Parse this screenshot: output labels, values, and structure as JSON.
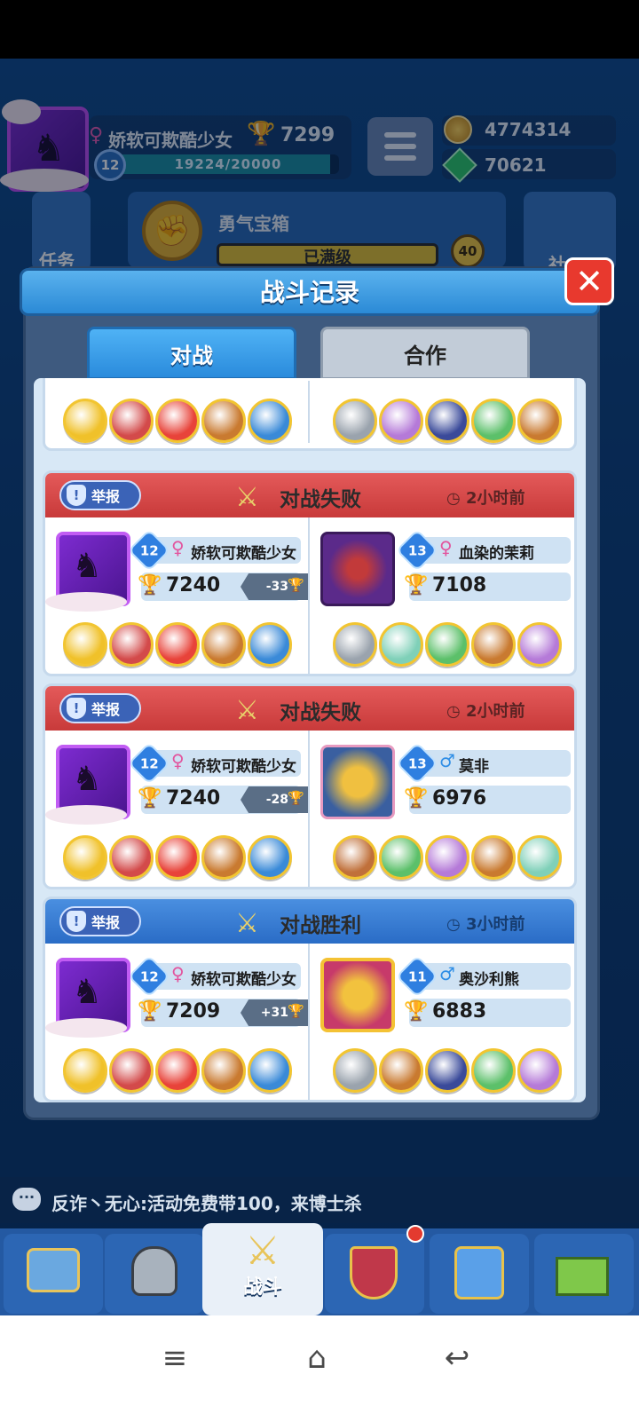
{
  "hud": {
    "player_name": "娇软可欺酷少女",
    "trophies": "7299",
    "level": "12",
    "xp": "19224/20000",
    "xp_fraction": 0.9612,
    "coins": "4774314",
    "gems": "70621"
  },
  "chest": {
    "title": "勇气宝箱",
    "status": "已满级",
    "level": "40"
  },
  "side": {
    "tasks_label": "任务",
    "social_label": "社"
  },
  "modal": {
    "title": "战斗记录",
    "close_label": "✕",
    "tabs": [
      {
        "label": "对战",
        "active": true
      },
      {
        "label": "合作",
        "active": false
      }
    ]
  },
  "report_label": "举报",
  "records": [
    {
      "result": "对战失败",
      "outcome": "lose",
      "time": "2小时前",
      "self": {
        "level": "12",
        "gender": "♀",
        "name": "娇软可欺酷少女",
        "trophies": "7240",
        "delta": "-33",
        "heroes": [
          "yellow",
          "red",
          "clown",
          "bear",
          "blue"
        ]
      },
      "opponent": {
        "level": "13",
        "gender": "♀",
        "name": "血染的茉莉",
        "trophies": "7108",
        "heroes": [
          "knight",
          "teal",
          "green",
          "bear",
          "purple"
        ]
      }
    },
    {
      "result": "对战失败",
      "outcome": "lose",
      "time": "2小时前",
      "self": {
        "level": "12",
        "gender": "♀",
        "name": "娇软可欺酷少女",
        "trophies": "7240",
        "delta": "-28",
        "heroes": [
          "yellow",
          "red",
          "clown",
          "bear",
          "blue"
        ]
      },
      "opponent": {
        "level": "13",
        "gender": "♂",
        "name": "莫非",
        "trophies": "6976",
        "heroes": [
          "monkey",
          "green",
          "purple",
          "bear",
          "teal"
        ]
      }
    },
    {
      "result": "对战胜利",
      "outcome": "win",
      "time": "3小时前",
      "self": {
        "level": "12",
        "gender": "♀",
        "name": "娇软可欺酷少女",
        "trophies": "7209",
        "delta": "+31",
        "heroes": [
          "yellow",
          "red",
          "clown",
          "bear",
          "blue"
        ]
      },
      "opponent": {
        "level": "11",
        "gender": "♂",
        "name": "奥沙利熊",
        "trophies": "6883",
        "heroes": [
          "knight",
          "bear",
          "ninja",
          "green",
          "purple"
        ]
      }
    }
  ],
  "hero_colors": {
    "yellow": "#f0c12a",
    "red": "#d34a4a",
    "clown": "#e8433a",
    "bear": "#c97a30",
    "blue": "#3a8ad8",
    "knight": "#9aa3ad",
    "purple": "#b57ad8",
    "ninja": "#3a4a9a",
    "green": "#5cc06a",
    "teal": "#7fd0b8",
    "monkey": "#c0703a"
  },
  "chat": {
    "icon": "···",
    "message": "反诈丶无心:活动免费带100，来博士杀"
  },
  "bottom_tabs": {
    "battle_label": "战斗"
  }
}
